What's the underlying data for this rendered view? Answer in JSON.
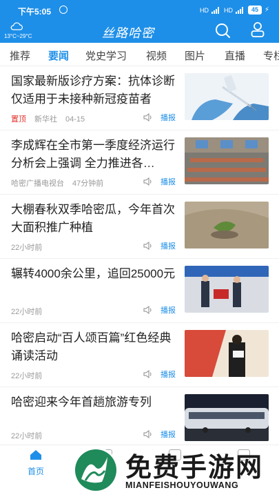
{
  "status_bar": {
    "time": "下午5:05",
    "battery": "45",
    "net_labels": [
      "HD",
      "4G",
      "HD",
      "4G"
    ]
  },
  "header": {
    "weather": "13°C~29°C",
    "app_title": "丝路哈密",
    "icons": [
      "cloud-icon",
      "search-icon",
      "user-icon"
    ]
  },
  "tabs": [
    {
      "label": "推荐",
      "active": false
    },
    {
      "label": "要闻",
      "active": true
    },
    {
      "label": "党史学习",
      "active": false
    },
    {
      "label": "视频",
      "active": false
    },
    {
      "label": "图片",
      "active": false
    },
    {
      "label": "直播",
      "active": false
    },
    {
      "label": "专栏",
      "active": false
    }
  ],
  "feed": [
    {
      "title": "国家最新版诊疗方案：抗体诊断仅适用于未接种新冠疫苗者",
      "pin": "置顶",
      "source": "新华社",
      "time": "04-15",
      "report": "播报",
      "thumb_icon": "vaccine-photo"
    },
    {
      "title": "李成辉在全市第一季度经济运行分析会上强调 全力推进各…",
      "pin": "",
      "source": "哈密广播电视台",
      "time": "47分钟前",
      "report": "播报",
      "thumb_icon": "meeting-photo"
    },
    {
      "title": "大棚春秋双季哈密瓜，今年首次大面积推广种植",
      "pin": "",
      "source": "",
      "time": "22小时前",
      "report": "播报",
      "thumb_icon": "greenhouse-photo"
    },
    {
      "title": "辗转4000余公里，追回25000元",
      "pin": "",
      "source": "",
      "time": "22小时前",
      "report": "播报",
      "thumb_icon": "police-photo"
    },
    {
      "title": "哈密启动“百人颂百篇”红色经典诵读活动",
      "pin": "",
      "source": "",
      "time": "22小时前",
      "report": "播报",
      "thumb_icon": "reading-photo"
    },
    {
      "title": "哈密迎来今年首趟旅游专列",
      "pin": "",
      "source": "",
      "time": "22小时前",
      "report": "播报",
      "thumb_icon": "train-photo"
    }
  ],
  "bottom_nav": {
    "home_label": "首页"
  },
  "watermark": {
    "text": "免费手游网",
    "sub": "MIANFEISHOUYOUWANG"
  },
  "colors": {
    "brand": "#1e8fe8",
    "pin": "#e2332e"
  }
}
